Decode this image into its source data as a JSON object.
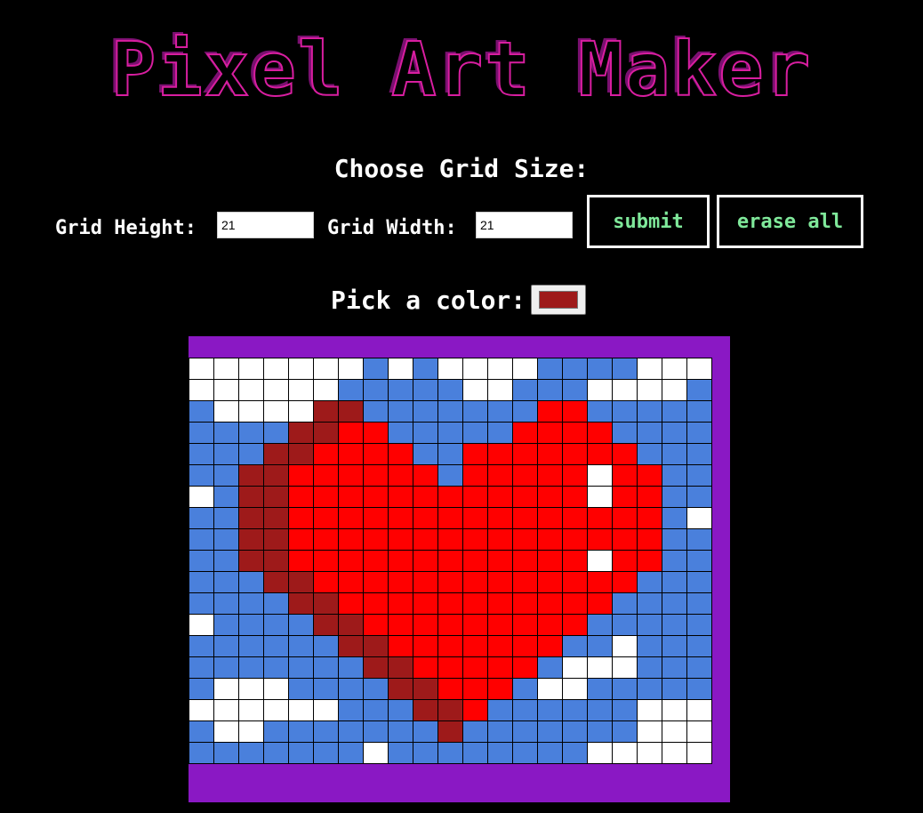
{
  "title": "Pixel Art Maker",
  "subtitle": "Choose Grid Size:",
  "size_form": {
    "height_label": "Grid Height:",
    "height_value": "21",
    "width_label": "Grid Width:",
    "width_value": "21",
    "submit_label": "submit",
    "erase_label": "erase all"
  },
  "color_picker": {
    "label": "Pick a color:",
    "value": "#9e1a1a"
  },
  "colors": {
    "W": "#ffffff",
    "B": "#4a80dc",
    "D": "#9e1a1a",
    "R": "#ff0000",
    "frame": "#8a18c4",
    "title_stroke": "#d81ea0",
    "button_text": "#7fe89a"
  },
  "grid": {
    "rows": 19,
    "cols": 21,
    "cells": [
      "WWWWWWWBWBWWWWBBBBWWW",
      "WWWWWWBBBBBWWBBBWWWWB",
      "BWWWWDDBBBBBBBRRBBBBB",
      "BBBBDDRRBBBBBRRRRBBBB",
      "BBBDDRRRRBBRRRRRRRBBB",
      "BBDDRRRRRRBRRRRRWRRBB",
      "WBDDRRRRRRRRRRRRWRRBB",
      "BBDDRRRRRRRRRRRRRRRBW",
      "BBDDRRRRRRRRRRRRRRRBB",
      "BBDDRRRRRRRRRRRRWRRBB",
      "BBBDDRRRRRRRRRRRRRBBB",
      "BBBBDDRRRRRRRRRRRBBBB",
      "WBBBBDDRRRRRRRRRBBBBB",
      "BBBBBBDDRRRRRRRBBWBBB",
      "BBBBBBBDDRRRRRBWWWBBB",
      "BWWWBBBBDDRRRBWWBBBBB",
      "WWWWWWBBBDDRBBBBBBWWW",
      "BWWBBBBBBBDBBBBBBBWWW",
      "BBBBBBBWBBBBBBBBWWWWW"
    ]
  }
}
